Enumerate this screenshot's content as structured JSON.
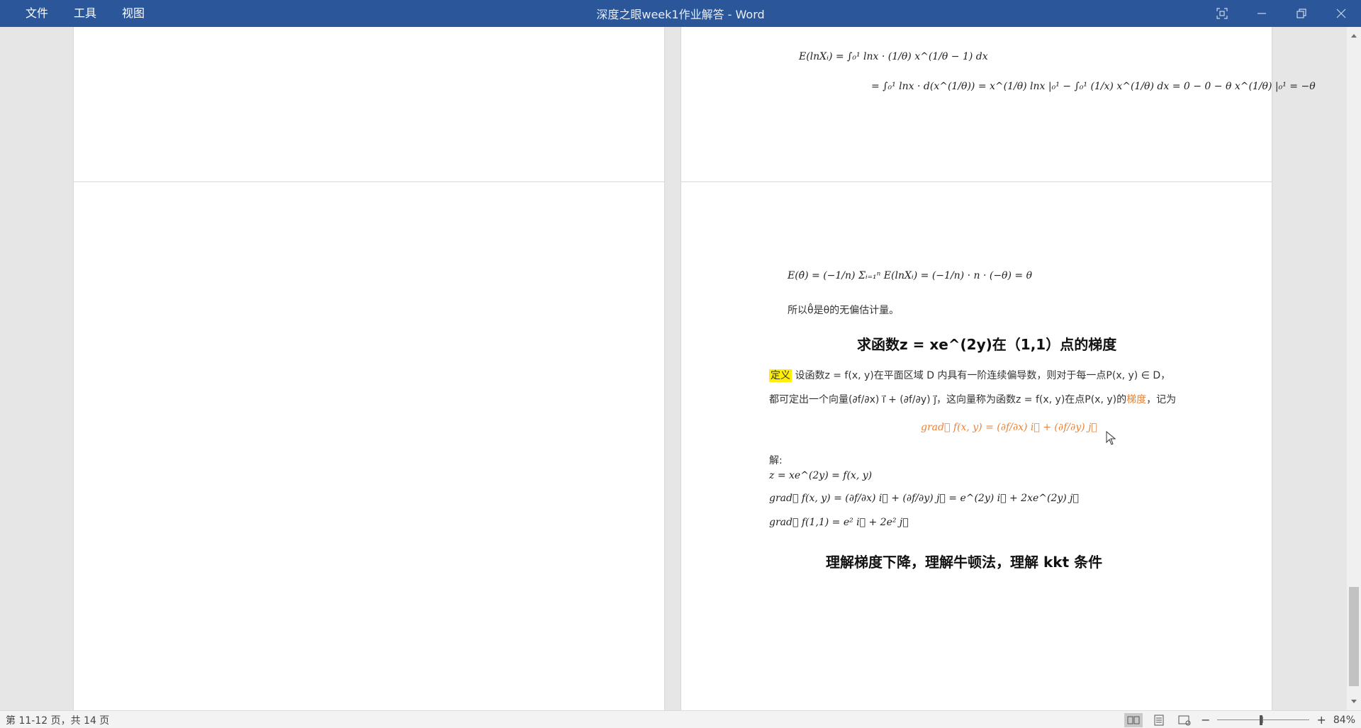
{
  "menu": {
    "items": [
      "文件",
      "工具",
      "视图"
    ]
  },
  "window": {
    "title": "深度之眼week1作业解答 - Word"
  },
  "page2": {
    "line1": "E(lnXᵢ) = ∫₀¹ lnx · (1/θ) x^(1/θ − 1) dx",
    "line2": "= ∫₀¹ lnx · d(x^(1/θ)) = x^(1/θ) lnx |₀¹ − ∫₀¹ (1/x) x^(1/θ) dx = 0 − 0 − θ x^(1/θ) |₀¹ = −θ"
  },
  "page4": {
    "eq_expectation": "E(θ̂) = (−1/n) Σᵢ₌₁ⁿ E(lnXᵢ) = (−1/n) · n · (−θ) = θ",
    "conclusion": "所以θ̂是θ的无偏估计量。",
    "heading1": "求函数z = xe^(2y)在（1,1）点的梯度",
    "definition_label": "定义",
    "definition_text": "设函数z = f(x, y)在平面区域 D 内具有一阶连续偏导数，则对于每一点P(x, y) ∈ D，",
    "definition_text2a": "都可定出一个向量(∂f/∂x) i⃗ + (∂f/∂y) j⃗，这向量称为函数z = f(x, y)在点P(x, y)的",
    "definition_keyword": "梯度",
    "definition_text2b": "，记为",
    "grad_formula": "grad⃗ f(x, y) = (∂f/∂x) i⃗ + (∂f/∂y) j⃗",
    "solution_label": "解:",
    "sol1": "z = xe^(2y) = f(x, y)",
    "sol2": "grad⃗ f(x, y) = (∂f/∂x) i⃗ + (∂f/∂y) j⃗ = e^(2y) i⃗ + 2xe^(2y) j⃗",
    "sol3": "grad⃗ f(1,1) = e² i⃗ + 2e² j⃗",
    "heading2": "理解梯度下降，理解牛顿法，理解 kkt 条件"
  },
  "status": {
    "page_info": "第 11-12 页，共 14 页",
    "zoom": "84%",
    "zoom_percent": 84
  },
  "colors": {
    "titlebar": "#2b579a",
    "highlight": "#ffef00",
    "accent_orange": "#e8833a"
  }
}
